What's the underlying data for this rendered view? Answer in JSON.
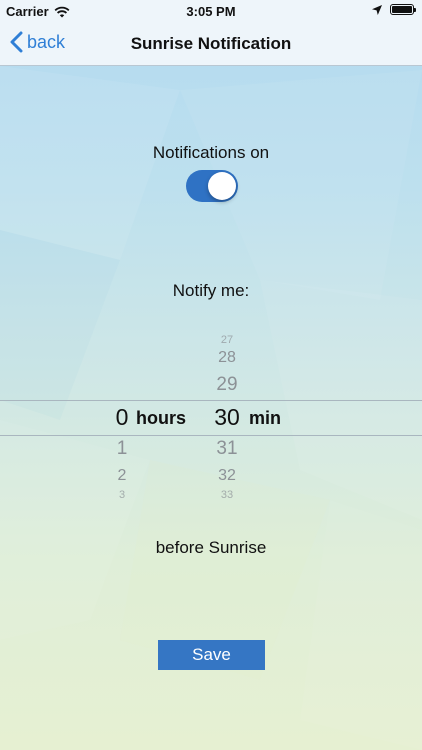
{
  "status_bar": {
    "carrier": "Carrier",
    "time": "3:05 PM"
  },
  "nav": {
    "back_label": "back",
    "title": "Sunrise Notification"
  },
  "notifications": {
    "label": "Notifications on",
    "enabled": true
  },
  "notify_label": "Notify me:",
  "picker": {
    "hours": {
      "above": [],
      "selected": "0",
      "below": [
        "1",
        "2",
        "3"
      ],
      "unit": "hours"
    },
    "minutes": {
      "above": [
        "27",
        "28",
        "29"
      ],
      "selected": "30",
      "below": [
        "31",
        "32",
        "33"
      ],
      "unit": "min"
    }
  },
  "before_label": "before Sunrise",
  "save_label": "Save",
  "colors": {
    "accent": "#2f7fd6",
    "toggle_on": "#2f72c4",
    "button": "#3576c4"
  }
}
